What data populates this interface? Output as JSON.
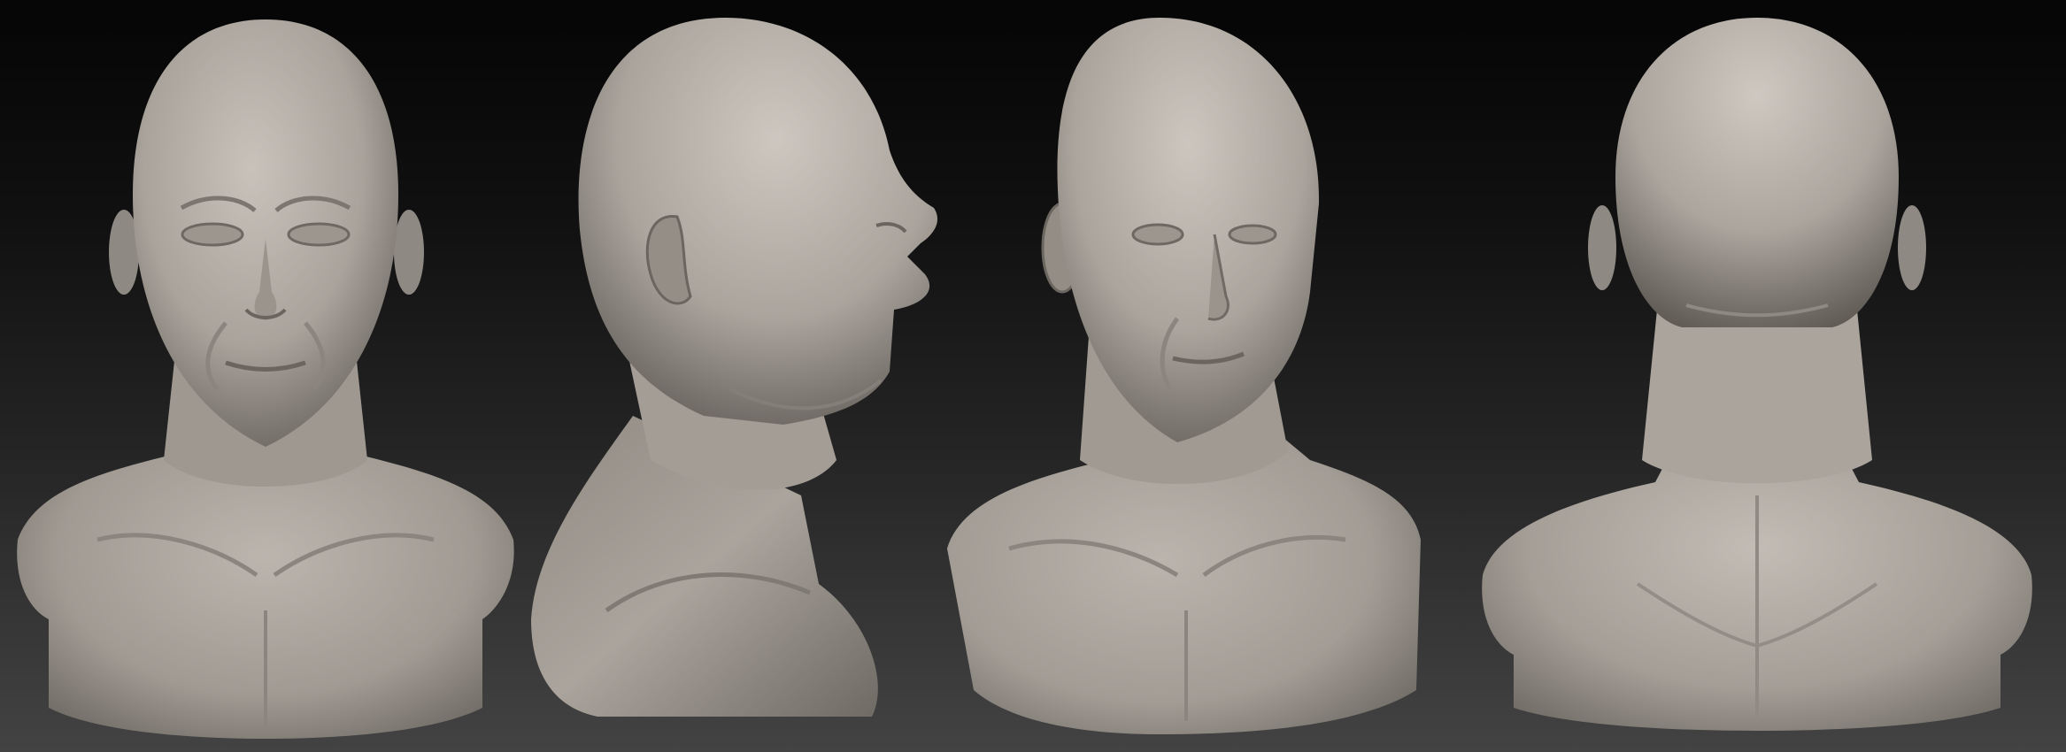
{
  "scene": {
    "type": "sculpt-turnaround",
    "background": {
      "top": "#050505",
      "bottom": "#434343"
    },
    "material_color": "#a9a39c",
    "views": [
      {
        "id": "front",
        "name": "front-view"
      },
      {
        "id": "side",
        "name": "side-profile-view"
      },
      {
        "id": "three_quarter",
        "name": "three-quarter-view"
      },
      {
        "id": "back",
        "name": "back-view"
      }
    ]
  }
}
